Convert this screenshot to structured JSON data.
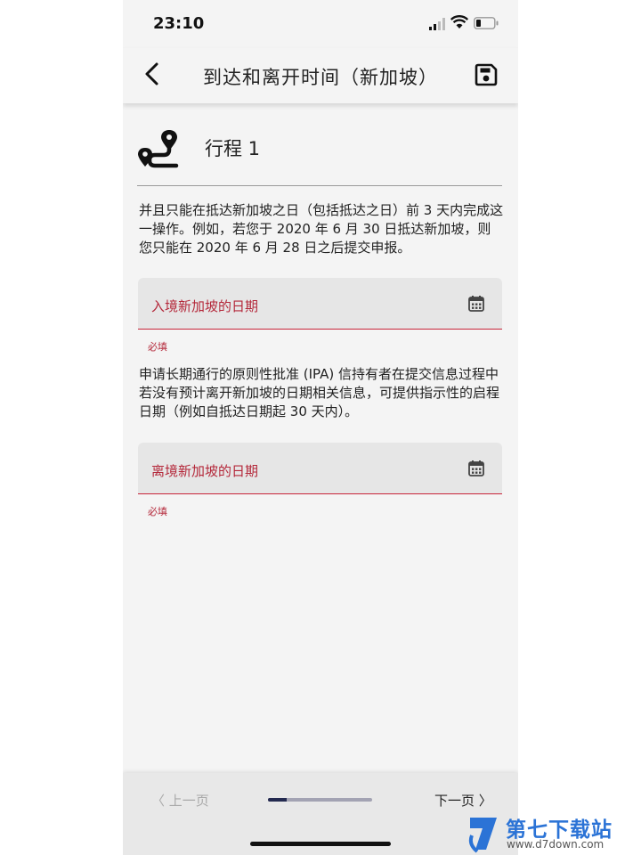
{
  "status_bar": {
    "time": "23:10"
  },
  "header": {
    "title": "到达和离开时间（新加坡）"
  },
  "trip": {
    "title": "行程 1"
  },
  "notice_1": "并且只能在抵达新加坡之日（包括抵达之日）前 3 天内完成这一操作。例如，若您于 2020 年 6 月 30 日抵达新加坡，则您只能在 2020 年 6 月 28 日之后提交申报。",
  "arrival_field": {
    "label": "入境新加坡的日期",
    "helper": "必填"
  },
  "notice_2": "申请长期通行的原则性批准 (IPA) 信持有者在提交信息过程中若没有预计离开新加坡的日期相关信息，可提供指示性的启程日期（例如自抵达日期起 30 天内）。",
  "departure_field": {
    "label": "离境新加坡的日期",
    "helper": "必填"
  },
  "footer": {
    "prev_label": "〈 上一页",
    "next_label": "下一页 〉",
    "progress": 0.18
  },
  "watermark": {
    "name": "第七下载站",
    "url": "www.d7down.com"
  },
  "colors": {
    "accent_red": "#b4283a",
    "progress_dark": "#242a50",
    "watermark_blue": "#2b73d6"
  }
}
